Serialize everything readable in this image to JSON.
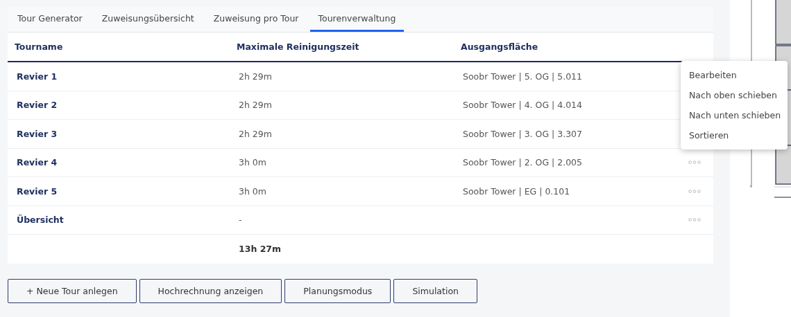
{
  "tabs": [
    {
      "label": "Tour Generator",
      "selected": false
    },
    {
      "label": "Zuweisungsübersicht",
      "selected": false
    },
    {
      "label": "Zuweisung pro Tour",
      "selected": false
    },
    {
      "label": "Tourenverwaltung",
      "selected": true
    }
  ],
  "table": {
    "columns": [
      "Tourname",
      "Maximale Reinigungszeit",
      "Ausgangsfläche"
    ],
    "rows": [
      {
        "kind": "tour",
        "name": "Revier 1",
        "time": "2h 29m",
        "area": "Soobr Tower | 5. OG | 5.011"
      },
      {
        "kind": "tour",
        "name": "Revier 2",
        "time": "2h 29m",
        "area": "Soobr Tower | 4. OG | 4.014"
      },
      {
        "kind": "tour",
        "name": "Revier 3",
        "time": "2h 29m",
        "area": "Soobr Tower | 3. OG | 3.307"
      },
      {
        "kind": "tour",
        "name": "Revier 4",
        "time": "3h 0m",
        "area": "Soobr Tower | 2. OG | 2.005"
      },
      {
        "kind": "tour",
        "name": "Revier 5",
        "time": "3h 0m",
        "area": "Soobr Tower | EG | 0.101"
      },
      {
        "kind": "summary",
        "name": "Übersicht",
        "time": "-"
      },
      {
        "kind": "total",
        "time": "13h 27m"
      }
    ]
  },
  "context_menu": [
    "Bearbeiten",
    "Nach oben schieben",
    "Nach unten schieben",
    "Sortieren"
  ],
  "buttons": [
    "+ Neue Tour anlegen",
    "Hochrechnung anzeigen",
    "Planungsmodus",
    "Simulation"
  ]
}
